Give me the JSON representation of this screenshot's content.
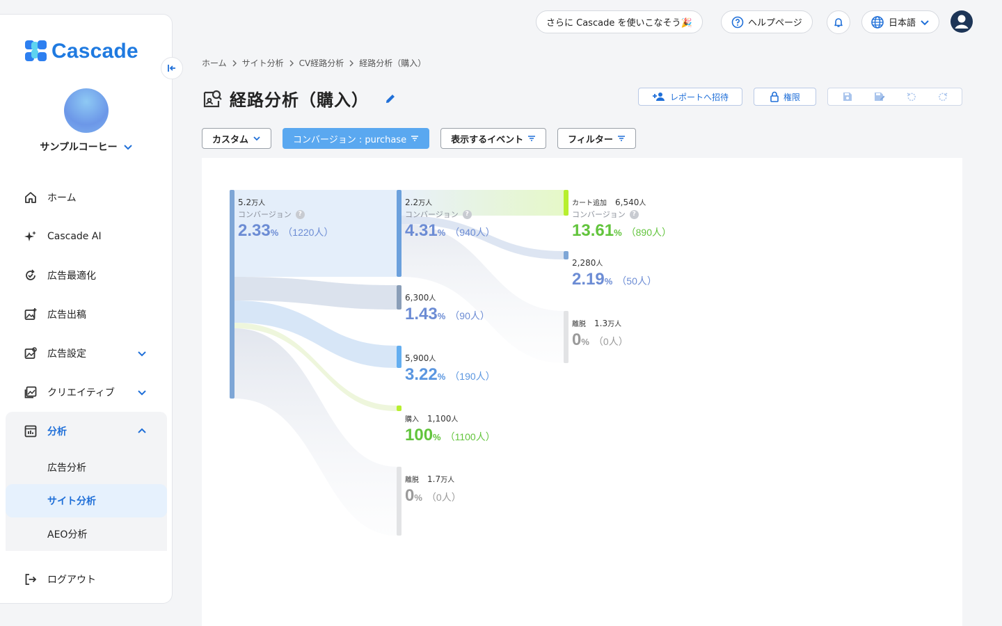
{
  "app": {
    "brand": "Cascade",
    "org_name": "サンプルコーヒー"
  },
  "topbar": {
    "promo_label": "さらに Cascade を使いこなそう🎉",
    "help_label": "ヘルプページ",
    "language_label": "日本語"
  },
  "sidebar": {
    "items": [
      {
        "label": "ホーム",
        "icon": "home-icon"
      },
      {
        "label": "Cascade AI",
        "icon": "sparkle-icon"
      },
      {
        "label": "広告最適化",
        "icon": "refresh-check-icon"
      },
      {
        "label": "広告出稿",
        "icon": "image-plus-icon"
      },
      {
        "label": "広告設定",
        "icon": "image-gear-icon"
      },
      {
        "label": "クリエイティブ",
        "icon": "gallery-icon"
      },
      {
        "label": "分析",
        "icon": "chart-icon"
      }
    ],
    "sub_items": [
      {
        "label": "広告分析"
      },
      {
        "label": "サイト分析"
      },
      {
        "label": "AEO分析"
      }
    ],
    "logout_label": "ログアウト"
  },
  "breadcrumb": [
    "ホーム",
    "サイト分析",
    "CV経路分析",
    "経路分析（購入）"
  ],
  "page": {
    "title": "経路分析（購入）",
    "invite_label": "レポートへ招待",
    "permission_label": "権限"
  },
  "filters": {
    "custom_label": "カスタム",
    "conversion_label": "コンバージョン : purchase",
    "events_label": "表示するイベント",
    "filter_label": "フィルター"
  },
  "sankey": {
    "cv_label": "コンバージョン",
    "nodes": [
      {
        "id": "root",
        "name": "",
        "users_num": "5.2",
        "users_unit": "万人",
        "rate": "2.33",
        "count": "（1220人）",
        "color": "blue",
        "show_cv": true
      },
      {
        "id": "a",
        "name": "",
        "users_num": "2.2",
        "users_unit": "万人",
        "rate": "4.31",
        "count": "（940人）",
        "color": "blue",
        "show_cv": true
      },
      {
        "id": "b",
        "name": "",
        "users_num": "6,300",
        "users_unit": "人",
        "rate": "1.43",
        "count": "（90人）",
        "color": "blue",
        "show_cv": false
      },
      {
        "id": "c",
        "name": "",
        "users_num": "5,900",
        "users_unit": "人",
        "rate": "3.22",
        "count": "（190人）",
        "color": "blue",
        "show_cv": false
      },
      {
        "id": "d",
        "name": "購入",
        "users_num": "1,100",
        "users_unit": "人",
        "rate": "100",
        "count": "（1100人）",
        "color": "green",
        "show_cv": false
      },
      {
        "id": "e",
        "name": "離脱",
        "users_num": "1.7",
        "users_unit": "万人",
        "rate": "0",
        "count": "（0人）",
        "color": "gray",
        "show_cv": false
      },
      {
        "id": "f",
        "name": "カート追加",
        "users_num": "6,540",
        "users_unit": "人",
        "rate": "13.61",
        "count": "（890人）",
        "color": "green",
        "show_cv": true
      },
      {
        "id": "g",
        "name": "",
        "users_num": "2,280",
        "users_unit": "人",
        "rate": "2.19",
        "count": "（50人）",
        "color": "blue",
        "show_cv": false
      },
      {
        "id": "h",
        "name": "離脱",
        "users_num": "1.3",
        "users_unit": "万人",
        "rate": "0",
        "count": "（0人）",
        "color": "gray",
        "show_cv": false
      }
    ],
    "pct_sign": "%"
  },
  "colors": {
    "accent": "#1f6fd8",
    "brand": "#1f7ae0",
    "node_blue": "#6ba0dc",
    "node_green": "#b7ef2e",
    "node_gray": "#e2e3e5"
  }
}
